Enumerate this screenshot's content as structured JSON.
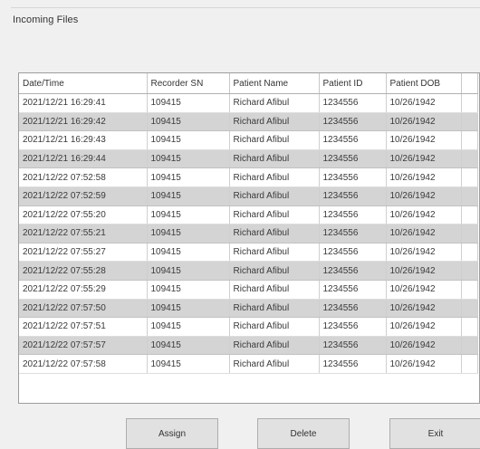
{
  "window": {
    "title": "Incoming Files"
  },
  "table": {
    "columns": [
      "Date/Time",
      "Recorder SN",
      "Patient Name",
      "Patient ID",
      "Patient DOB"
    ],
    "rows": [
      {
        "date_time": "2021/12/21 16:29:41",
        "recorder_sn": "109415",
        "patient_name": "Richard Afibul",
        "patient_id": "1234556",
        "patient_dob": "10/26/1942",
        "shaded": false
      },
      {
        "date_time": "2021/12/21 16:29:42",
        "recorder_sn": "109415",
        "patient_name": "Richard Afibul",
        "patient_id": "1234556",
        "patient_dob": "10/26/1942",
        "shaded": true
      },
      {
        "date_time": "2021/12/21 16:29:43",
        "recorder_sn": "109415",
        "patient_name": "Richard Afibul",
        "patient_id": "1234556",
        "patient_dob": "10/26/1942",
        "shaded": false
      },
      {
        "date_time": "2021/12/21 16:29:44",
        "recorder_sn": "109415",
        "patient_name": "Richard Afibul",
        "patient_id": "1234556",
        "patient_dob": "10/26/1942",
        "shaded": true
      },
      {
        "date_time": "2021/12/22 07:52:58",
        "recorder_sn": "109415",
        "patient_name": "Richard Afibul",
        "patient_id": "1234556",
        "patient_dob": "10/26/1942",
        "shaded": false
      },
      {
        "date_time": "2021/12/22 07:52:59",
        "recorder_sn": "109415",
        "patient_name": "Richard Afibul",
        "patient_id": "1234556",
        "patient_dob": "10/26/1942",
        "shaded": true
      },
      {
        "date_time": "2021/12/22 07:55:20",
        "recorder_sn": "109415",
        "patient_name": "Richard Afibul",
        "patient_id": "1234556",
        "patient_dob": "10/26/1942",
        "shaded": false
      },
      {
        "date_time": "2021/12/22 07:55:21",
        "recorder_sn": "109415",
        "patient_name": "Richard Afibul",
        "patient_id": "1234556",
        "patient_dob": "10/26/1942",
        "shaded": true
      },
      {
        "date_time": "2021/12/22 07:55:27",
        "recorder_sn": "109415",
        "patient_name": "Richard Afibul",
        "patient_id": "1234556",
        "patient_dob": "10/26/1942",
        "shaded": false
      },
      {
        "date_time": "2021/12/22 07:55:28",
        "recorder_sn": "109415",
        "patient_name": "Richard Afibul",
        "patient_id": "1234556",
        "patient_dob": "10/26/1942",
        "shaded": true
      },
      {
        "date_time": "2021/12/22 07:55:29",
        "recorder_sn": "109415",
        "patient_name": "Richard Afibul",
        "patient_id": "1234556",
        "patient_dob": "10/26/1942",
        "shaded": false
      },
      {
        "date_time": "2021/12/22 07:57:50",
        "recorder_sn": "109415",
        "patient_name": "Richard Afibul",
        "patient_id": "1234556",
        "patient_dob": "10/26/1942",
        "shaded": true
      },
      {
        "date_time": "2021/12/22 07:57:51",
        "recorder_sn": "109415",
        "patient_name": "Richard Afibul",
        "patient_id": "1234556",
        "patient_dob": "10/26/1942",
        "shaded": false
      },
      {
        "date_time": "2021/12/22 07:57:57",
        "recorder_sn": "109415",
        "patient_name": "Richard Afibul",
        "patient_id": "1234556",
        "patient_dob": "10/26/1942",
        "shaded": true
      },
      {
        "date_time": "2021/12/22 07:57:58",
        "recorder_sn": "109415",
        "patient_name": "Richard Afibul",
        "patient_id": "1234556",
        "patient_dob": "10/26/1942",
        "shaded": false
      }
    ]
  },
  "buttons": {
    "assign": "Assign",
    "delete": "Delete",
    "exit": "Exit"
  },
  "colors": {
    "window_background": "#f0f0f0",
    "table_background": "#ffffff",
    "shaded_row": "#d4d4d4",
    "button_face": "#e1e1e1",
    "button_border": "#adadad"
  }
}
